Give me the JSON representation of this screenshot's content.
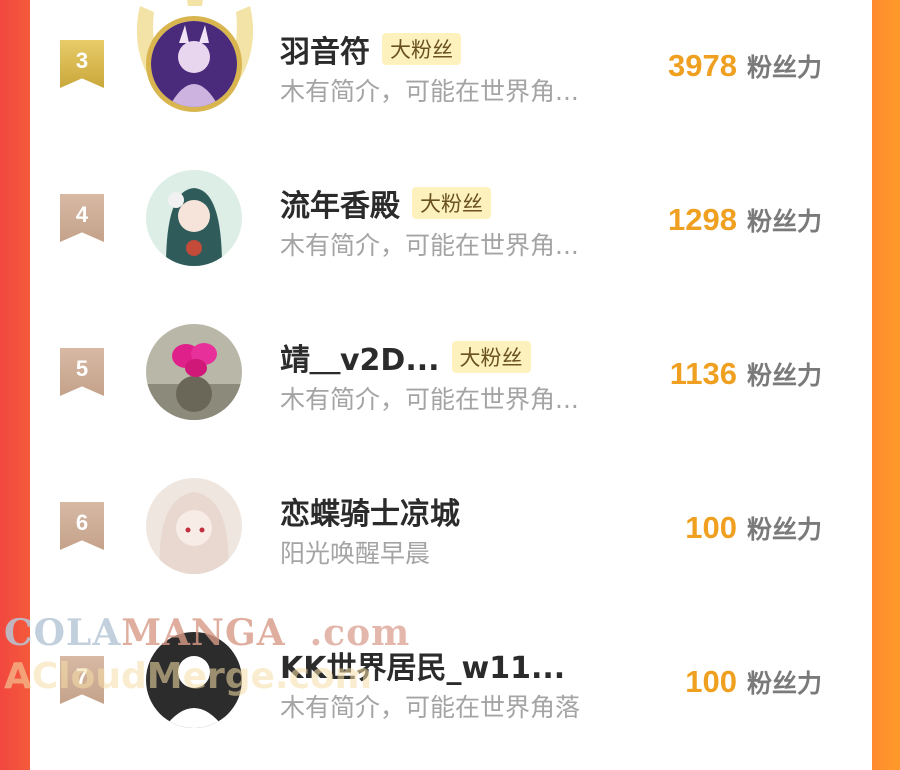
{
  "colors": {
    "accent_score": "#f0a020",
    "badge_bg": "#fdf2be",
    "left_edge": "#f2473f",
    "right_edge": "#ff9a2a"
  },
  "fans": [
    {
      "rank": "3",
      "name": "羽音符",
      "badge": "大粉丝",
      "desc": "木有简介，可能在世界角...",
      "score": "3978",
      "unit": "粉丝力"
    },
    {
      "rank": "4",
      "name": "流年香殿",
      "badge": "大粉丝",
      "desc": "木有简介，可能在世界角...",
      "score": "1298",
      "unit": "粉丝力"
    },
    {
      "rank": "5",
      "name": "靖＿v2D...",
      "badge": "大粉丝",
      "desc": "木有简介，可能在世界角...",
      "score": "1136",
      "unit": "粉丝力"
    },
    {
      "rank": "6",
      "name": "恋蝶骑士凉城",
      "desc": "阳光唤醒早晨",
      "score": "100",
      "unit": "粉丝力"
    },
    {
      "rank": "7",
      "name": "KK世界居民_w11...",
      "desc": "木有简介，可能在世界角落",
      "score": "100",
      "unit": "粉丝力"
    }
  ],
  "watermark": {
    "line1_a": "COLA",
    "line1_b": "MANGA",
    "line1_c": ".com",
    "line2": "ACloudMerge.com"
  }
}
